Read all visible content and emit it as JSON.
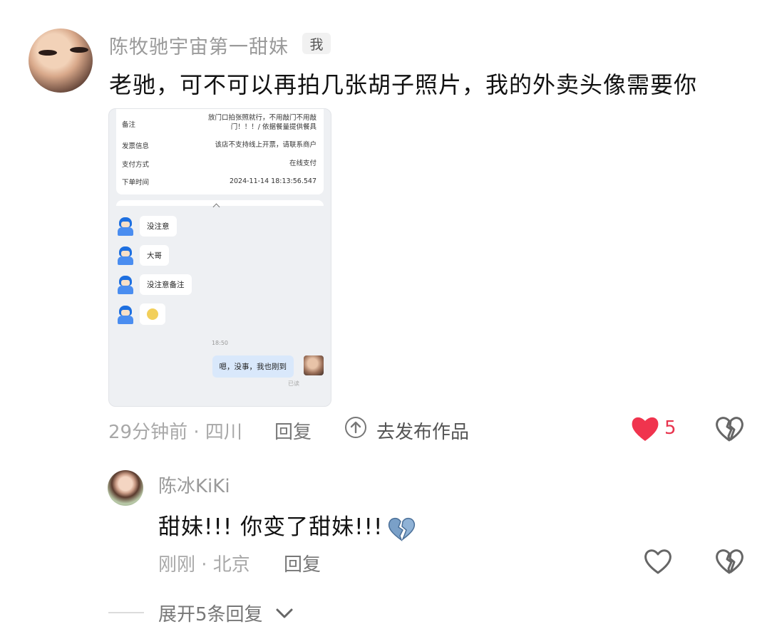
{
  "comment": {
    "username": "陈牧驰宇宙第一甜妹",
    "badge": "我",
    "text": "老驰，可不可以再拍几张胡子照片，我的外卖头像需要你",
    "time_location": "29分钟前 · 四川",
    "reply_label": "回复",
    "publish_label": "去发布作品",
    "like_count": "5"
  },
  "screenshot": {
    "order": [
      {
        "key": "备注",
        "value": "放门口拍张照就行，不用敲门不用敲门！！！/ 依据餐量提供餐具"
      },
      {
        "key": "发票信息",
        "value": "该店不支持线上开票，请联系商户"
      },
      {
        "key": "支付方式",
        "value": "在线支付"
      },
      {
        "key": "下单时间",
        "value": "2024-11-14 18:13:56.547"
      }
    ],
    "messages_in": [
      "没注意",
      "大哥",
      "没注意备注",
      "😶"
    ],
    "time": "18:50",
    "message_out": "嗯，没事，我也刚到",
    "read": "已读"
  },
  "reply": {
    "username": "陈冰KiKi",
    "text": "甜妹!!! 你变了甜妹!!!",
    "time_location": "刚刚 · 北京",
    "reply_label": "回复"
  },
  "expand_label": "展开5条回复",
  "colors": {
    "like": "#f0344e",
    "muted_text": "#a8a8a8",
    "broken_heart": "#7aa0c8"
  },
  "icons": [
    "publish-icon",
    "heart-filled-icon",
    "broken-heart-icon",
    "heart-outline-icon",
    "chevron-down-icon"
  ]
}
